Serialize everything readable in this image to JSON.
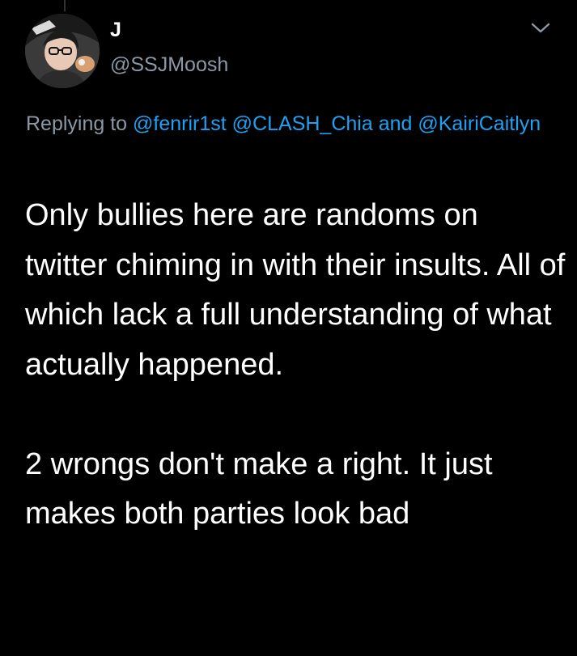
{
  "tweet": {
    "author": {
      "display_name": "J",
      "handle": "@SSJMoosh",
      "avatar_icon": "avatar-icon"
    },
    "menu_icon": "chevron-down-icon",
    "reply": {
      "prefix": "Replying to",
      "mentions": [
        "@fenrir1st",
        "@CLASH_Chia",
        "@KairiCaitlyn"
      ],
      "conjunction": "and"
    },
    "text": "Only bullies here are randoms on twitter chiming in with their insults. All of which lack a full understanding of what actually happened.\n\n2 wrongs don't make a right. It just makes both parties look bad"
  },
  "colors": {
    "background": "#000000",
    "primary_text": "#ffffff",
    "secondary_text": "#8b98a5",
    "link": "#1da1f2"
  }
}
